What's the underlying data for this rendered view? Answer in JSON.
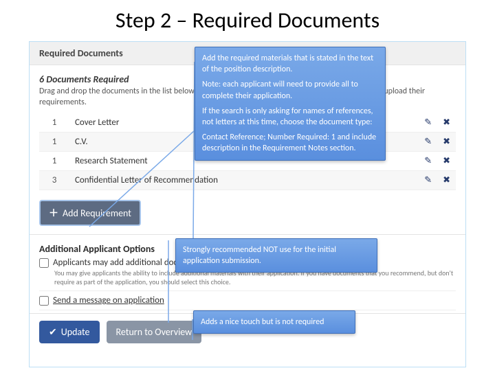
{
  "title": "Step 2 – Required Documents",
  "panel": {
    "header": "Required Documents",
    "docs_required": "6 Documents Required",
    "hint": "Drag and drop the documents in the list below to change the order in which applicants will be asked to upload their requirements.",
    "rows": [
      {
        "qty": "1",
        "label": "Cover Letter"
      },
      {
        "qty": "1",
        "label": "C.V."
      },
      {
        "qty": "1",
        "label": "Research Statement"
      },
      {
        "qty": "3",
        "label": "Confidential Letter of Recommendation"
      }
    ],
    "add_requirement": "Add Requirement",
    "additional_heading": "Additional Applicant Options",
    "opt_add_docs": "Applicants may add additional documents",
    "opt_add_docs_desc": "You may give applicants the ability to include additional materials with their application. If you have documents that you recommend, but don't require as part of the application, you should select this choice.",
    "opt_send_msg": "Send a message on application",
    "update": "Update",
    "return": "Return to Overview"
  },
  "callouts": {
    "c1_p1": "Add the required materials that is stated in the text of the position description.",
    "c1_p2": "Note: each applicant will need to provide all to complete their application.",
    "c1_p3": "If the search is only asking for names of references, not letters at this time, choose the document type:",
    "c1_p4": "Contact Reference; Number Required: 1 and include description in the Requirement Notes section.",
    "c2": "Strongly recommended NOT use for the initial application submission.",
    "c3": "Adds a nice touch but is not required"
  }
}
